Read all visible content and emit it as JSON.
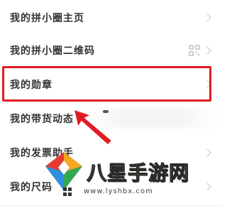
{
  "menu": {
    "items": [
      {
        "label": "我的拼小圈主页"
      },
      {
        "label": "我的拼小圈二维码"
      },
      {
        "label": "我的勋章"
      },
      {
        "label": "我的带货动态"
      },
      {
        "label": "我的发票助手"
      },
      {
        "label": "我的尺码"
      }
    ]
  },
  "watermark": {
    "title": "八星手游网",
    "url": "www.lyshbx.com"
  },
  "colors": {
    "highlight": "#e01d24",
    "watermark_gold": "#f1c232"
  },
  "icons": [
    "chevron-right-icon",
    "qr-code-icon",
    "pointer-arrow-icon"
  ]
}
